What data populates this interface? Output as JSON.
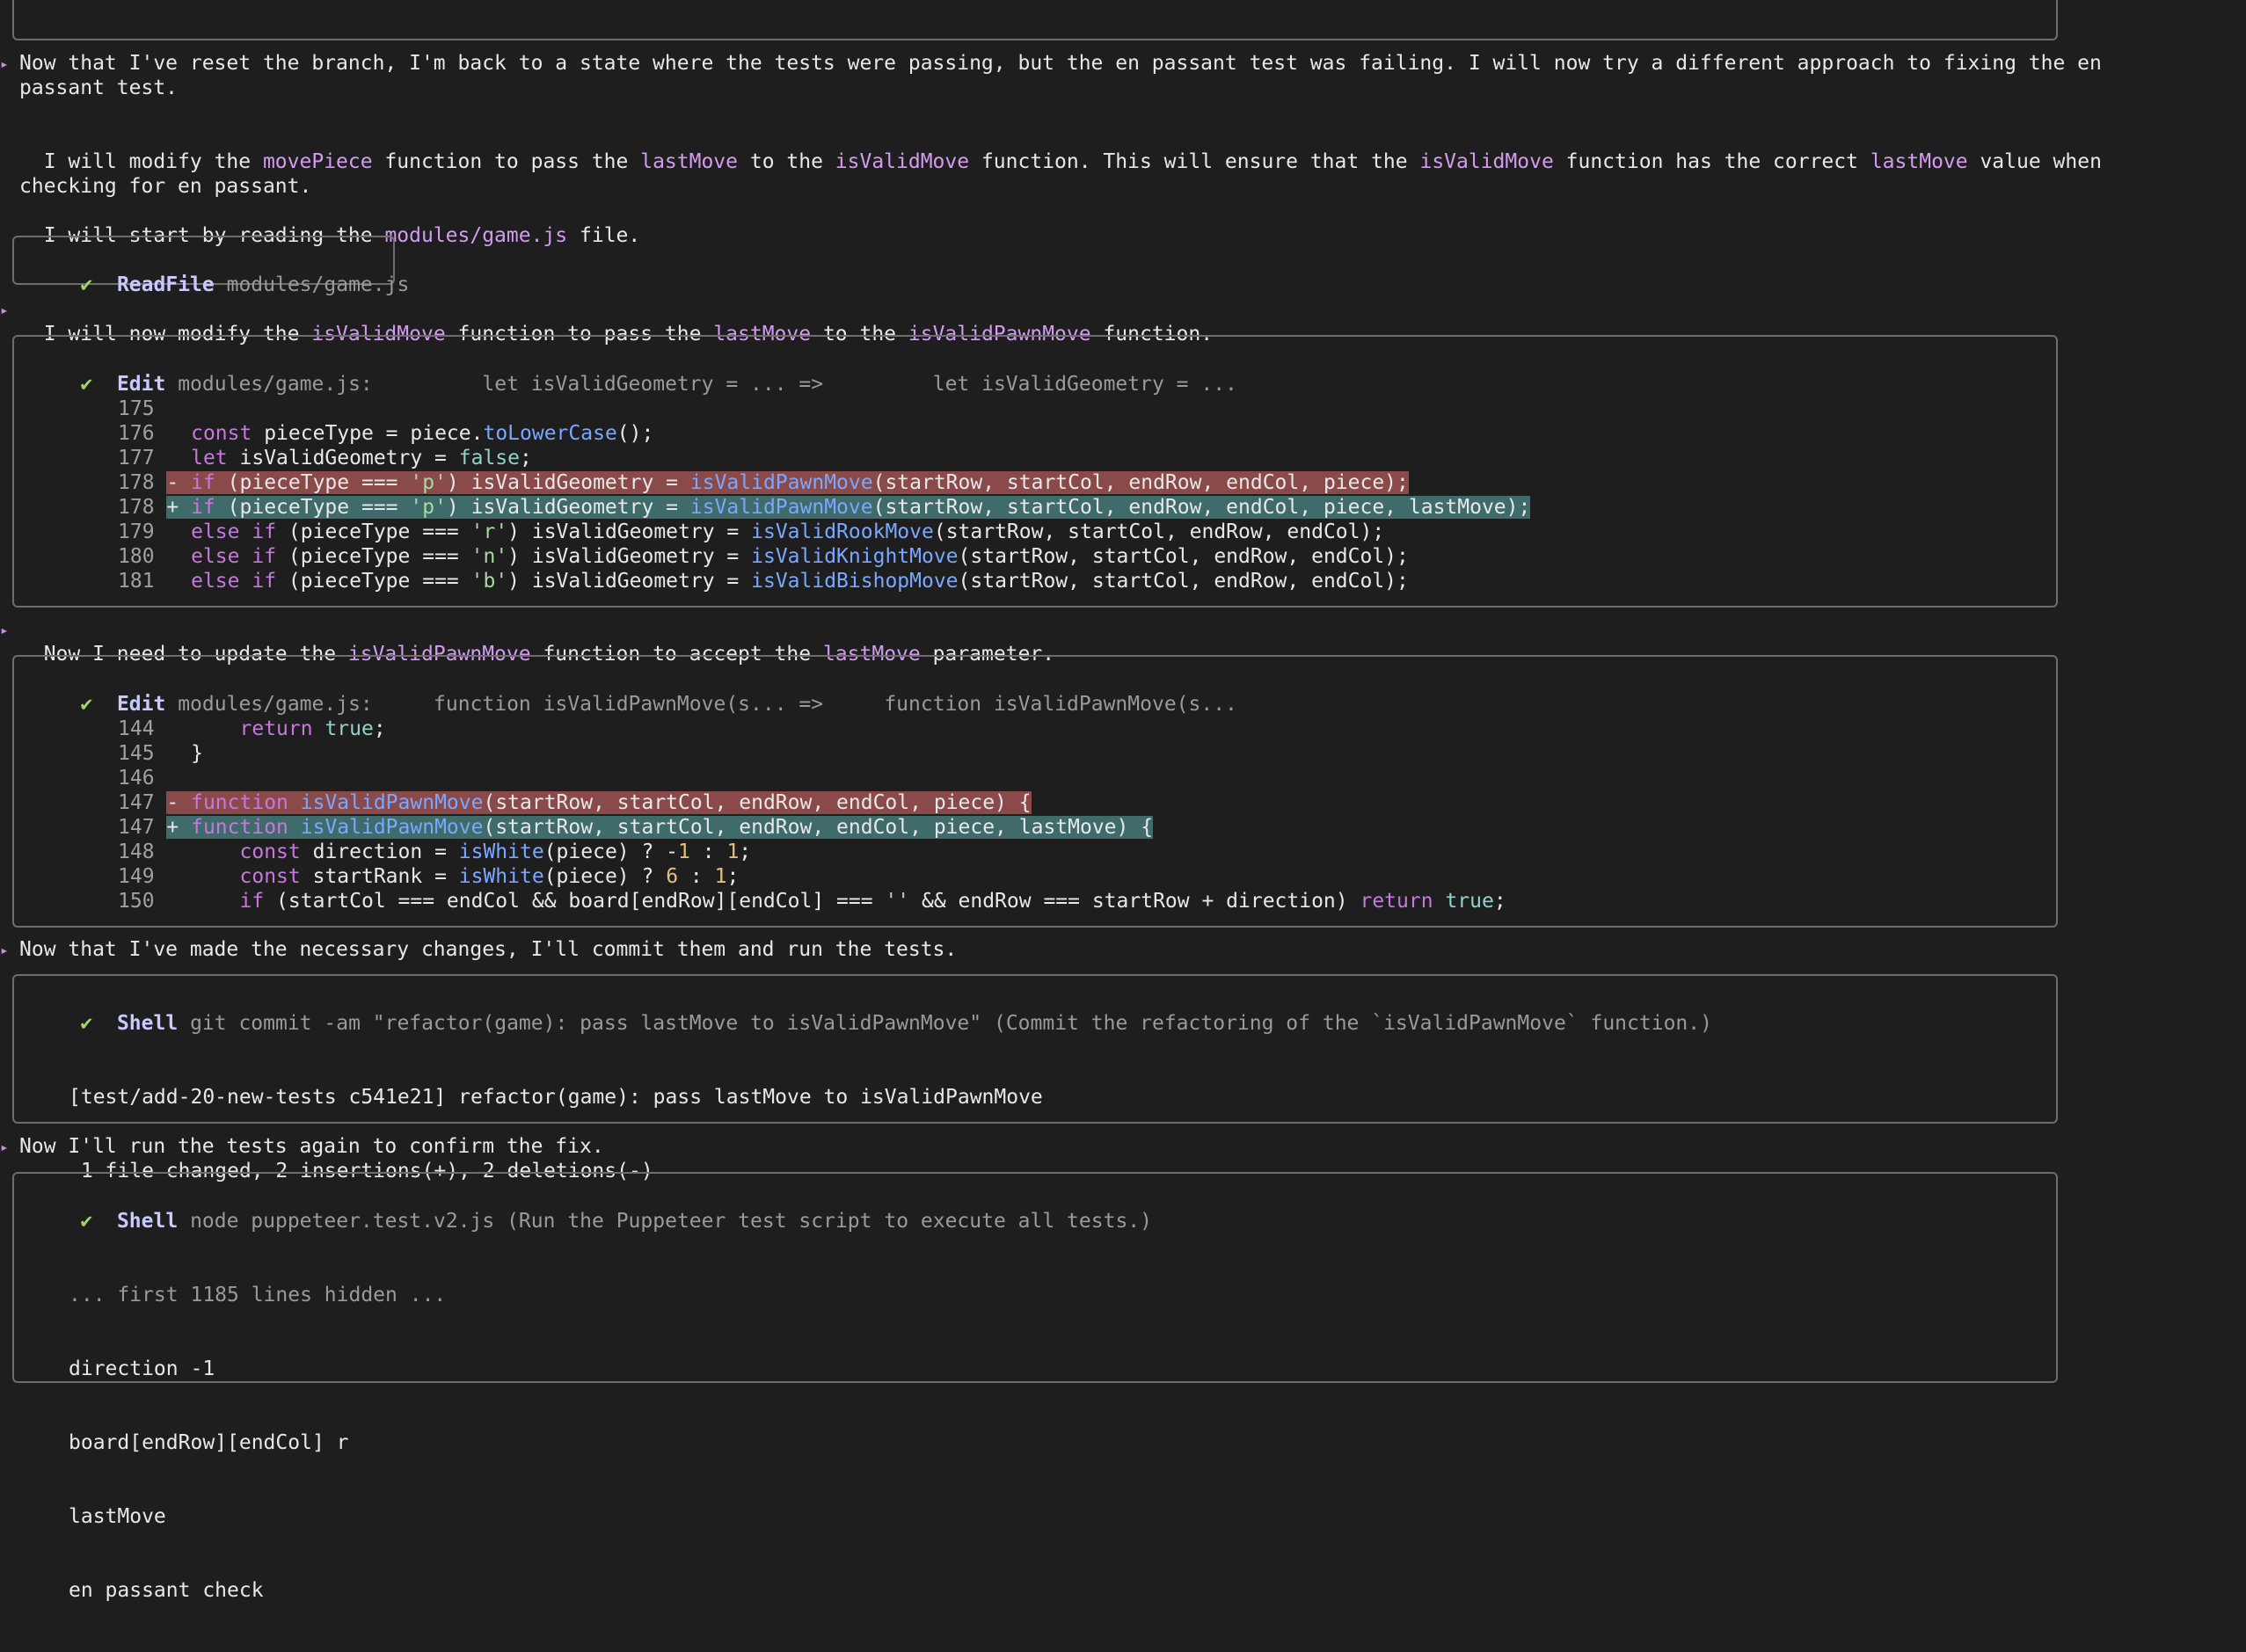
{
  "messages": {
    "m1": "Now that I've reset the branch, I'm back to a state where the tests were passing, but the en passant test was failing. I will now try a different approach to fixing the en passant test.",
    "m2_parts": [
      "I will modify the ",
      "movePiece",
      " function to pass the ",
      "lastMove",
      " to the ",
      "isValidMove",
      " function. This will ensure that the ",
      "isValidMove",
      " function has the correct ",
      "lastMove",
      " value when checking for en passant."
    ],
    "m3_parts": [
      "I will start by reading the ",
      "modules/game.js",
      " file."
    ],
    "m4_parts": [
      "I will now modify the ",
      "isValidMove",
      " function to pass the ",
      "lastMove",
      " to the ",
      "isValidPawnMove",
      " function."
    ],
    "m5_parts": [
      "Now I need to update the ",
      "isValidPawnMove",
      " function to accept the ",
      "lastMove",
      " parameter."
    ],
    "m6": "Now that I've made the necessary changes, I'll commit them and run the tests.",
    "m7": "Now I'll run the tests again to confirm the fix."
  },
  "tools": {
    "read": {
      "check": "✔",
      "name": "ReadFile",
      "arg": "modules/game.js"
    },
    "edit1": {
      "check": "✔",
      "name": "Edit",
      "arg": "modules/game.js:         let isValidGeometry = ... =>         let isValidGeometry = ...",
      "lines": [
        {
          "n": "175",
          "code": ""
        },
        {
          "n": "176",
          "code": "  const pieceType = piece.toLowerCase();"
        },
        {
          "n": "177",
          "code": "  let isValidGeometry = false;"
        },
        {
          "n": "178",
          "code": "- if (pieceType === 'p') isValidGeometry = isValidPawnMove(startRow, startCol, endRow, endCol, piece);"
        },
        {
          "n": "178",
          "code": "+ if (pieceType === 'p') isValidGeometry = isValidPawnMove(startRow, startCol, endRow, endCol, piece, lastMove);"
        },
        {
          "n": "179",
          "code": "  else if (pieceType === 'r') isValidGeometry = isValidRookMove(startRow, startCol, endRow, endCol);"
        },
        {
          "n": "180",
          "code": "  else if (pieceType === 'n') isValidGeometry = isValidKnightMove(startRow, startCol, endRow, endCol);"
        },
        {
          "n": "181",
          "code": "  else if (pieceType === 'b') isValidGeometry = isValidBishopMove(startRow, startCol, endRow, endCol);"
        }
      ]
    },
    "edit2": {
      "check": "✔",
      "name": "Edit",
      "arg": "modules/game.js:     function isValidPawnMove(s... =>     function isValidPawnMove(s...",
      "lines": [
        {
          "n": "144",
          "code": "      return true;"
        },
        {
          "n": "145",
          "code": "  }"
        },
        {
          "n": "146",
          "code": ""
        },
        {
          "n": "147",
          "code": "- function isValidPawnMove(startRow, startCol, endRow, endCol, piece) {"
        },
        {
          "n": "147",
          "code": "+ function isValidPawnMove(startRow, startCol, endRow, endCol, piece, lastMove) {"
        },
        {
          "n": "148",
          "code": "      const direction = isWhite(piece) ? -1 : 1;"
        },
        {
          "n": "149",
          "code": "      const startRank = isWhite(piece) ? 6 : 1;"
        },
        {
          "n": "150",
          "code": "      if (startCol === endCol && board[endRow][endCol] === '' && endRow === startRow + direction) return true;"
        }
      ]
    },
    "shell1": {
      "check": "✔",
      "name": "Shell",
      "arg": "git commit -am \"refactor(game): pass lastMove to isValidPawnMove\" (Commit the refactoring of the `isValidPawnMove` function.)",
      "output": [
        "[test/add-20-new-tests c541e21] refactor(game): pass lastMove to isValidPawnMove",
        " 1 file changed, 2 insertions(+), 2 deletions(-)"
      ]
    },
    "shell2": {
      "check": "✔",
      "name": "Shell",
      "arg": "node puppeteer.test.v2.js (Run the Puppeteer test script to execute all tests.)",
      "hidden": "... first 1185 lines hidden ...",
      "output": [
        "direction -1",
        "board[endRow][endCol] r",
        "lastMove",
        "en passant check"
      ]
    }
  }
}
